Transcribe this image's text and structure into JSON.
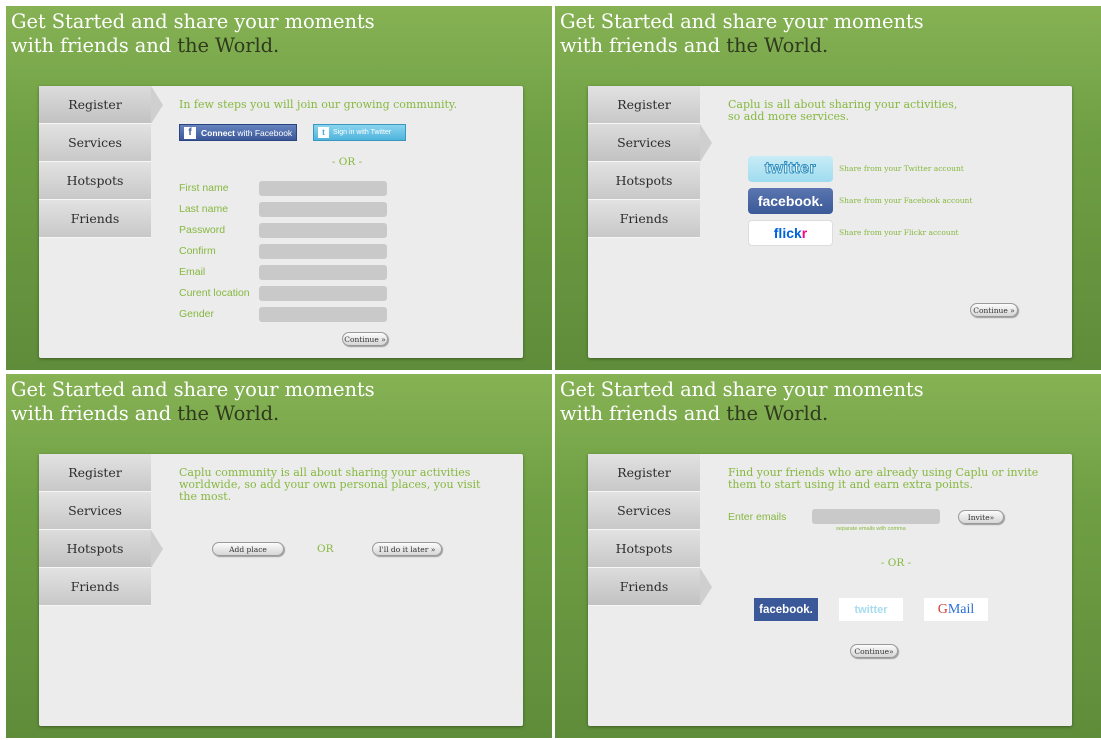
{
  "headline": {
    "line1": "Get Started and share your moments",
    "line2_prefix": "with friends and ",
    "line2_highlight": "the World."
  },
  "tabs": [
    "Register",
    "Services",
    "Hotspots",
    "Friends"
  ],
  "register": {
    "intro": "In few steps you will join our growing community.",
    "fb_connect_bold": "Connect",
    "fb_connect_rest": "with Facebook",
    "tw_signin": "Sign in with Twitter",
    "or": "- OR -",
    "fields": [
      "First name",
      "Last name",
      "Password",
      "Confirm",
      "Email",
      "Curent location",
      "Gender"
    ],
    "continue": "Continue »"
  },
  "services": {
    "intro_line1": "Caplu is all about sharing your activities,",
    "intro_line2": "so add more services.",
    "items": [
      {
        "logo": "twitter",
        "desc": "Share from your Twitter account"
      },
      {
        "logo": "facebook",
        "desc": "Share from your Facebook account"
      },
      {
        "logo": "flickr",
        "desc": "Share from your Flickr account"
      }
    ],
    "continue": "Continue »"
  },
  "hotspots": {
    "intro_line1": "Caplu community is all about sharing your activities",
    "intro_line2": "worldwide, so add your own personal places, you visit",
    "intro_line3": "the most.",
    "add_place": "Add place",
    "or": "OR",
    "later": "I'll do it later »"
  },
  "friends": {
    "intro_line1": "Find your friends who are already using Caplu or invite",
    "intro_line2": "them to start using it and earn extra points.",
    "emails_label": "Enter emails",
    "emails_hint": "separate emails with comma",
    "invite": "Invite»",
    "or": "- OR -",
    "share_logos": [
      "facebook",
      "twitter",
      "Gmail"
    ],
    "continue": "Continue»"
  },
  "colors": {
    "bg_green": "#6f9f44",
    "accent_green": "#86b840",
    "panel": "#ececec"
  }
}
